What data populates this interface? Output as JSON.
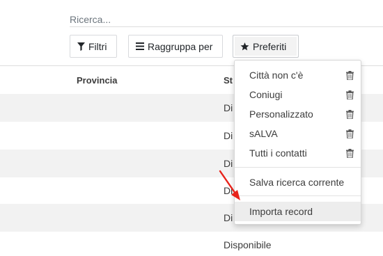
{
  "search": {
    "placeholder": "Ricerca..."
  },
  "toolbar": {
    "filters_label": "Filtri",
    "groupby_label": "Raggruppa per",
    "favorites_label": "Preferiti"
  },
  "table": {
    "headers": {
      "provincia": "Provincia",
      "stato": "St"
    },
    "rows": [
      {
        "stato": "Di"
      },
      {
        "stato": "Di"
      },
      {
        "stato": "Di"
      },
      {
        "stato": "Di"
      },
      {
        "stato": "Di"
      },
      {
        "stato": "Disponibile"
      }
    ]
  },
  "favorites_menu": {
    "saved_filters": [
      {
        "label": "Città non c'è"
      },
      {
        "label": "Coniugi"
      },
      {
        "label": "Personalizzato"
      },
      {
        "label": "sALVA"
      },
      {
        "label": "Tutti i contatti"
      }
    ],
    "save_current_label": "Salva ricerca corrente",
    "import_label": "Importa record"
  },
  "annotation": {
    "arrow_color": "#e8231b"
  },
  "icons": {
    "filter": "funnel-icon",
    "groupby": "bars-icon",
    "favorites": "star-icon",
    "delete": "trash-icon"
  }
}
